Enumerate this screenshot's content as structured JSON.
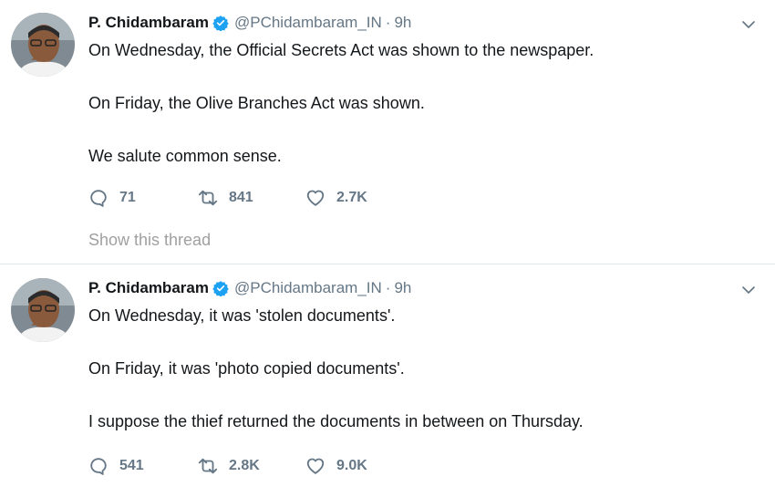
{
  "tweets": [
    {
      "author_name": "P. Chidambaram",
      "handle": "@PChidambaram_IN",
      "separator": "·",
      "time": "9h",
      "paragraphs": [
        "On Wednesday, the Official Secrets Act was shown to the newspaper.",
        "On Friday, the Olive Branches Act was shown.",
        "We salute common sense."
      ],
      "replies": "71",
      "retweets": "841",
      "likes": "2.7K",
      "show_thread": "Show this thread"
    },
    {
      "author_name": "P. Chidambaram",
      "handle": "@PChidambaram_IN",
      "separator": "·",
      "time": "9h",
      "paragraphs": [
        "On Wednesday, it was 'stolen documents'.",
        "On Friday, it was 'photo copied documents'.",
        "I suppose the thief returned the documents in between on Thursday."
      ],
      "replies": "541",
      "retweets": "2.8K",
      "likes": "9.0K"
    }
  ],
  "colors": {
    "verified": "#1da1f2",
    "secondary_text": "#657786",
    "divider": "#e1e8ed"
  },
  "icons": [
    "verified-badge-icon",
    "chevron-down-icon",
    "reply-icon",
    "retweet-icon",
    "like-icon"
  ]
}
